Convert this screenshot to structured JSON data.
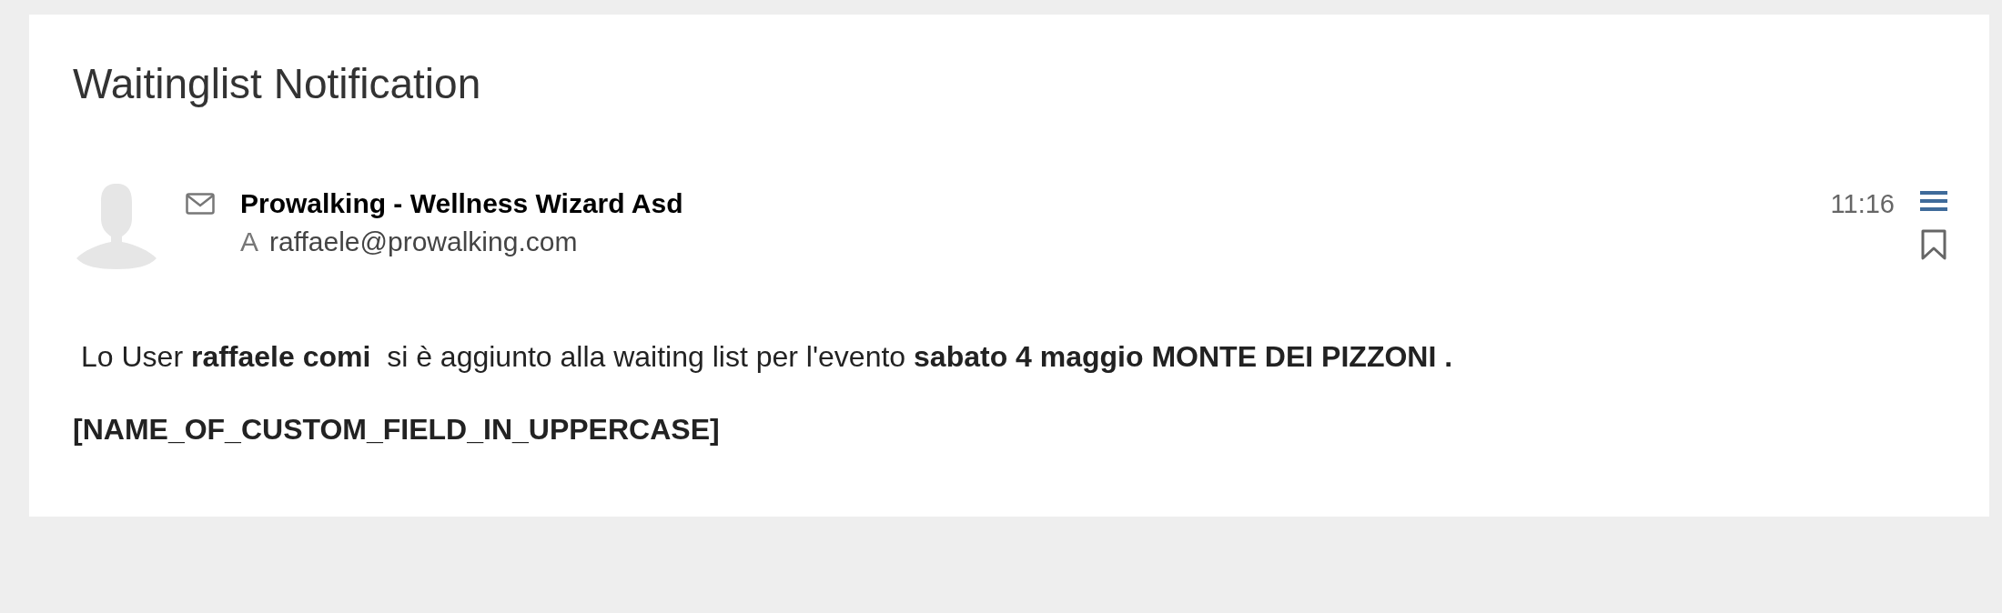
{
  "title": "Waitinglist Notification",
  "message": {
    "sender": "Prowalking - Wellness Wizard Asd",
    "recipient_prefix": "A",
    "recipient": "raffaele@prowalking.com",
    "time": "11:16"
  },
  "body": {
    "sentence": "Lo User **raffaele comi**  si è aggiunto alla waiting list per l'evento **sabato 4 maggio MONTE DEI PIZZONI .**",
    "field": "[NAME_OF_CUSTOM_FIELD_IN_UPPERCASE]"
  }
}
